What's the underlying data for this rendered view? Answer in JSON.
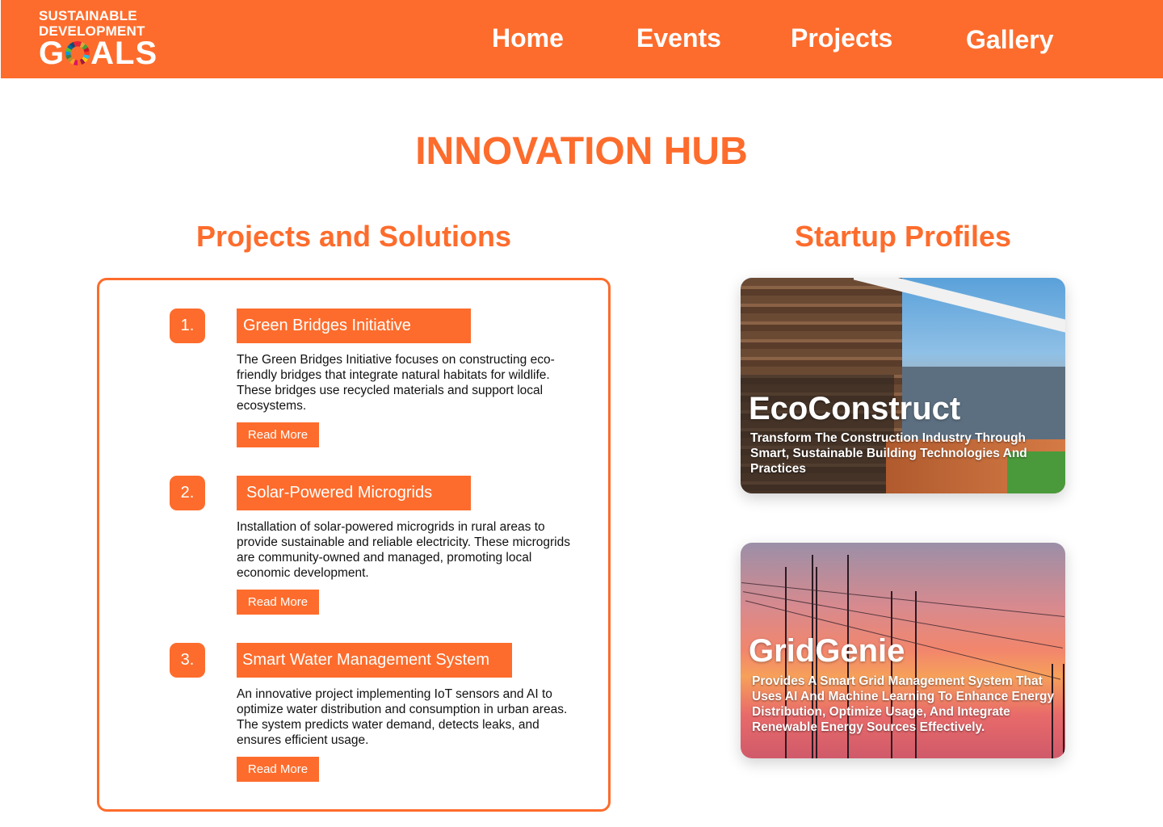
{
  "header": {
    "logo": {
      "line1": "SUSTAINABLE",
      "line2": "DEVELOPMENT",
      "line3_start": "G",
      "line3_end": "ALS"
    },
    "nav": [
      "Home",
      "Events",
      "Projects",
      "Gallery"
    ]
  },
  "page_title": "INNOVATION HUB",
  "projects": {
    "title": "Projects and Solutions",
    "items": [
      {
        "number": "1.",
        "title": "Green Bridges Initiative",
        "description": "The Green Bridges Initiative focuses on constructing eco-friendly bridges that integrate natural habitats for wildlife. These bridges use recycled materials and support local ecosystems.",
        "button": "Read More"
      },
      {
        "number": "2.",
        "title": "Solar-Powered Microgrids",
        "description": "Installation of solar-powered microgrids in rural areas to provide sustainable and reliable electricity. These microgrids are community-owned and managed, promoting local economic development.",
        "button": "Read More"
      },
      {
        "number": "3.",
        "title": "Smart Water Management System",
        "description": "An innovative project implementing IoT sensors and AI to optimize water distribution and consumption in urban areas. The system predicts water demand, detects leaks, and ensures efficient usage.",
        "button": "Read More"
      }
    ]
  },
  "startups": {
    "title": "Startup Profiles",
    "items": [
      {
        "name": "EcoConstruct",
        "description": "Transform The Construction Industry Through Smart, Sustainable Building Technologies And Practices"
      },
      {
        "name": "GridGenie",
        "description": "Provides A Smart Grid Management System That Uses AI And Machine Learning To Enhance Energy Distribution, Optimize Usage, And Integrate Renewable Energy Sources Effectively."
      }
    ]
  },
  "colors": {
    "accent": "#fd6c2c",
    "background": "#ffffff",
    "text": "#111111"
  }
}
